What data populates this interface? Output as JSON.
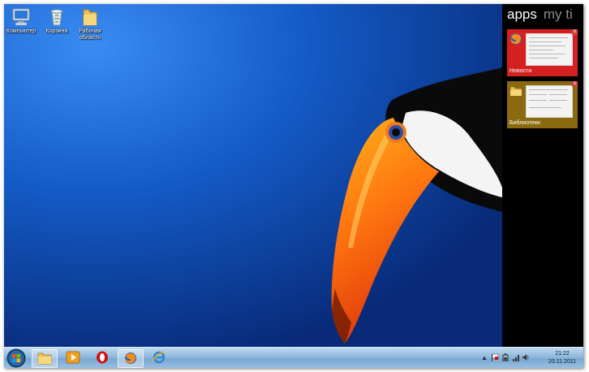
{
  "desktop": {
    "icons": [
      {
        "label": "Компьютер",
        "icon": "computer-icon"
      },
      {
        "label": "Корзина",
        "icon": "recycle-bin-icon"
      },
      {
        "label": "Рабочая область",
        "icon": "folder-icon"
      }
    ]
  },
  "apps_panel": {
    "tabs": [
      "apps",
      "my ti"
    ],
    "tiles": [
      {
        "label": "Новости",
        "icon": "firefox-icon",
        "color": "#d42020"
      },
      {
        "label": "Библиотеки",
        "icon": "folder-icon",
        "color": "#8b6a0f"
      }
    ],
    "close_glyph": "x"
  },
  "taskbar": {
    "pinned": [
      {
        "name": "explorer",
        "icon": "folder-icon",
        "active": true
      },
      {
        "name": "media-player",
        "icon": "media-player-icon",
        "active": false
      },
      {
        "name": "opera",
        "icon": "opera-icon",
        "active": false
      },
      {
        "name": "firefox",
        "icon": "firefox-icon",
        "active": true
      },
      {
        "name": "internet-explorer",
        "icon": "ie-icon",
        "active": false
      }
    ],
    "tray": {
      "show_hidden": "▲",
      "time": "21:22",
      "date": "20.11.2011"
    }
  },
  "colors": {
    "wallpaper": "#0b3f9a",
    "panel": "#000000",
    "taskbar": "#8db7dc"
  }
}
